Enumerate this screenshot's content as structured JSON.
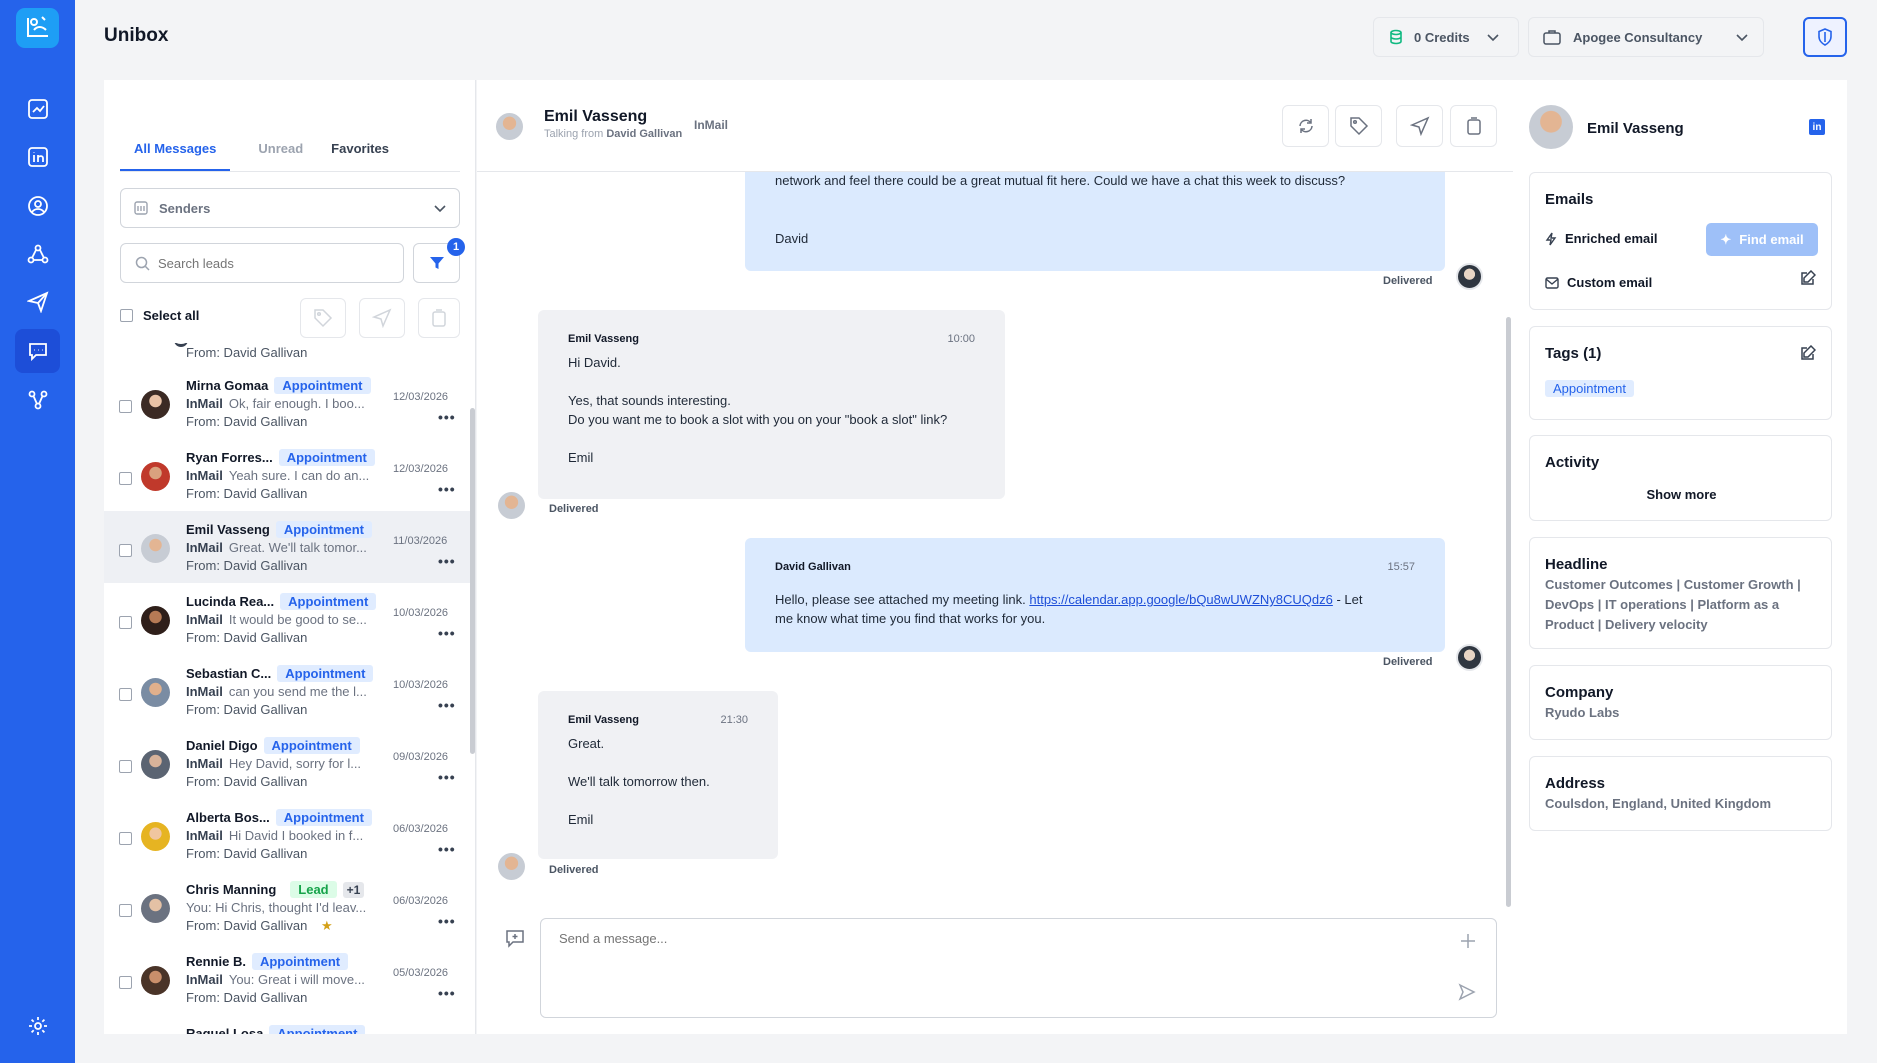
{
  "app": {
    "title": "Unibox"
  },
  "topbar": {
    "credits": "0 Credits",
    "company": "Apogee Consultancy"
  },
  "left": {
    "tabs": [
      "All Messages",
      "Unread",
      "Favorites"
    ],
    "senders_label": "Senders",
    "search_placeholder": "Search leads",
    "filter_count": "1",
    "select_all": "Select all",
    "partial_top_from": "From: David Gallivan",
    "conversations": [
      {
        "name": "Mirna Gomaa",
        "tag": "Appointment",
        "channel": "InMail",
        "preview": "Ok, fair enough. I boo...",
        "from": "From: David Gallivan",
        "date": "12/03/2026"
      },
      {
        "name": "Ryan Forres...",
        "tag": "Appointment",
        "channel": "InMail",
        "preview": "Yeah sure. I can do an...",
        "from": "From: David Gallivan",
        "date": "12/03/2026"
      },
      {
        "name": "Emil Vasseng",
        "tag": "Appointment",
        "channel": "InMail",
        "preview": "Great. We'll talk tomor...",
        "from": "From: David Gallivan",
        "date": "11/03/2026"
      },
      {
        "name": "Lucinda Rea...",
        "tag": "Appointment",
        "channel": "InMail",
        "preview": "It would be good to se...",
        "from": "From: David Gallivan",
        "date": "10/03/2026"
      },
      {
        "name": "Sebastian C...",
        "tag": "Appointment",
        "channel": "InMail",
        "preview": "can you send me the l...",
        "from": "From: David Gallivan",
        "date": "10/03/2026"
      },
      {
        "name": "Daniel Digo",
        "tag": "Appointment",
        "channel": "InMail",
        "preview": "Hey David, sorry for l...",
        "from": "From: David Gallivan",
        "date": "09/03/2026"
      },
      {
        "name": "Alberta Bos...",
        "tag": "Appointment",
        "channel": "InMail",
        "preview": "Hi David I booked in f...",
        "from": "From: David Gallivan",
        "date": "06/03/2026"
      },
      {
        "name": "Chris Manning",
        "tag": "Lead",
        "extra": "+1",
        "channel": "",
        "preview": "You: Hi Chris, thought I'd leav...",
        "from": "From: David Gallivan",
        "date": "06/03/2026"
      },
      {
        "name": "Rennie B.",
        "tag": "Appointment",
        "channel": "InMail",
        "preview": "You: Great i will move...",
        "from": "From: David Gallivan",
        "date": "05/03/2026"
      },
      {
        "name": "Raquel Losa",
        "tag": "Appointment",
        "channel": "",
        "preview": "",
        "from": "",
        "date": ""
      }
    ]
  },
  "chat": {
    "name": "Emil Vasseng",
    "talking_prefix": "Talking from",
    "talking_from": "David Gallivan",
    "channel": "InMail",
    "messages": [
      {
        "line1": "network and feel there could be a great mutual fit here. Could we have a chat this week to discuss?",
        "sign": "David",
        "status": "Delivered"
      },
      {
        "who": "Emil Vasseng",
        "time": "10:00",
        "body": "Hi David.\n\nYes, that sounds interesting.\nDo you want me to book a slot with you on your \"book a slot\" link?\n\nEmil",
        "status": "Delivered"
      },
      {
        "who": "David Gallivan",
        "time": "15:57",
        "pre": "Hello, please see attached my meeting link. ",
        "link": "https://calendar.app.google/bQu8wUWZNy8CUQdz6",
        "post": " - Let",
        "line2": "me know what time you find that works for you.",
        "status": "Delivered"
      },
      {
        "who": "Emil Vasseng",
        "time": "21:30",
        "body": "Great.\n\nWe'll talk tomorrow then.\n\nEmil",
        "status": "Delivered"
      }
    ],
    "compose_placeholder": "Send a message..."
  },
  "profile": {
    "name": "Emil Vasseng",
    "emails_title": "Emails",
    "enriched_label": "Enriched email",
    "find_email": "Find email",
    "custom_label": "Custom email",
    "tags_title": "Tags (1)",
    "tag": "Appointment",
    "activity_title": "Activity",
    "show_more": "Show more",
    "headline_title": "Headline",
    "headline_lines": [
      "Customer Outcomes | Customer Growth |",
      "DevOps | IT operations | Platform as a",
      "Product | Delivery velocity"
    ],
    "company_title": "Company",
    "company": "Ryudo Labs",
    "address_title": "Address",
    "address": "Coulsdon, England, United Kingdom"
  },
  "colors": {
    "accent": "#2563eb",
    "rail": "#2563eb",
    "bubble_out": "#dbeafe",
    "bubble_in": "#f0f1f4"
  }
}
